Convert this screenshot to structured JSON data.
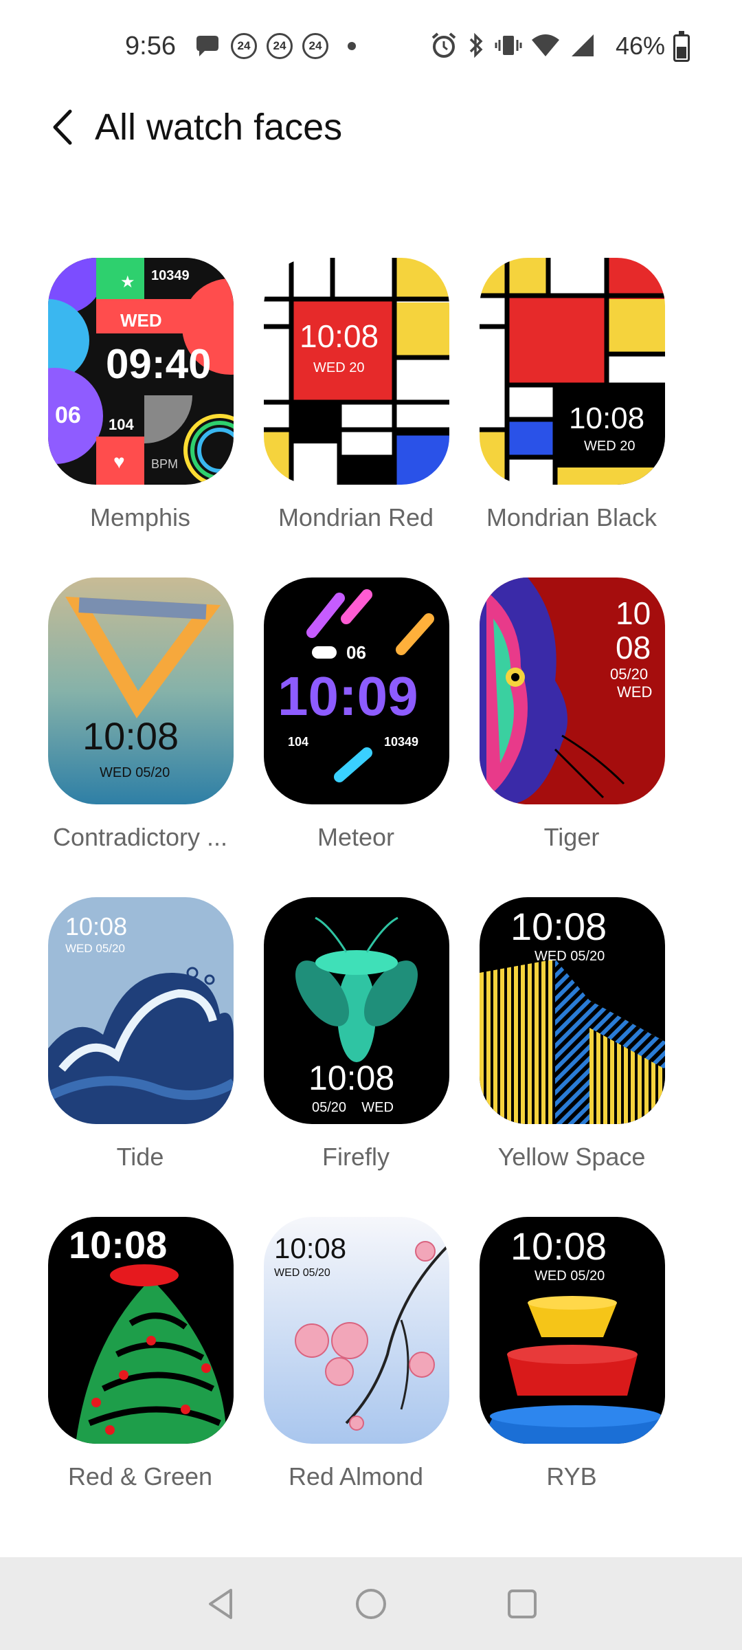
{
  "status_bar": {
    "time": "9:56",
    "badges": [
      "24",
      "24",
      "24"
    ],
    "battery": "46%",
    "icons": [
      "chat-icon",
      "alarm-icon",
      "bluetooth-icon",
      "vibrate-icon",
      "wifi-icon",
      "signal-icon",
      "battery-icon"
    ]
  },
  "header": {
    "title": "All watch faces",
    "back_icon": "chevron-left-icon"
  },
  "faces": [
    {
      "name": "Memphis",
      "time": "09:40",
      "day": "WED",
      "num1": "10349",
      "num2": "06",
      "num3": "104",
      "bpm": "BPM"
    },
    {
      "name": "Mondrian Red",
      "time": "10:08",
      "date": "WED  20"
    },
    {
      "name": "Mondrian Black",
      "time": "10:08",
      "date": "WED  20"
    },
    {
      "name": "Contradictory ...",
      "time": "10:08",
      "date": "WED  05/20"
    },
    {
      "name": "Meteor",
      "time": "10:09",
      "num1": "06",
      "num2": "104",
      "num3": "10349"
    },
    {
      "name": "Tiger",
      "hour": "10",
      "minute": "08",
      "date": "05/20",
      "day": "WED"
    },
    {
      "name": "Tide",
      "time": "10:08",
      "date": "WED 05/20"
    },
    {
      "name": "Firefly",
      "time": "10:08",
      "date": "05/20    WED"
    },
    {
      "name": "Yellow Space",
      "time": "10:08",
      "date": "WED 05/20"
    },
    {
      "name": "Red & Green",
      "time": "10:08"
    },
    {
      "name": "Red Almond",
      "time": "10:08",
      "date": "WED 05/20"
    },
    {
      "name": "RYB",
      "time": "10:08",
      "date": "WED 05/20"
    }
  ],
  "nav": {
    "back": "nav-back-icon",
    "home": "nav-home-icon",
    "recents": "nav-recents-icon"
  }
}
